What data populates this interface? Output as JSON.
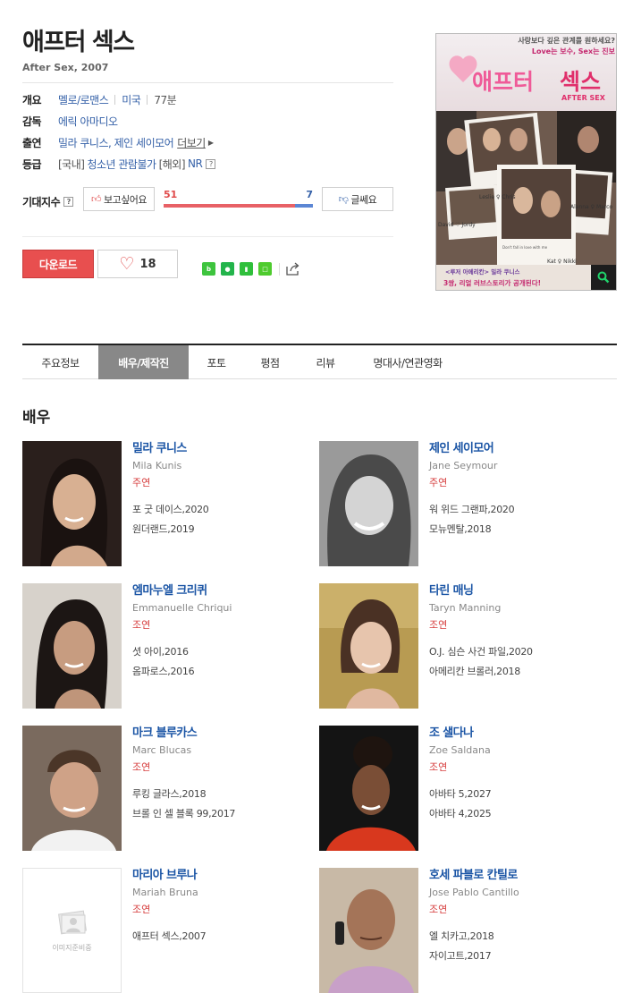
{
  "movie": {
    "title": "애프터 섹스",
    "subtitle": "After Sex, 2007"
  },
  "info": {
    "overview_label": "개요",
    "genre": "멜로/로맨스",
    "country": "미국",
    "runtime": "77분",
    "director_label": "감독",
    "director": "에릭 아마디오",
    "cast_label": "출연",
    "cast_summary": "밀라 쿠니스, 제인 세이모어",
    "more_label": "더보기",
    "rating_label": "등급",
    "rating_domestic_prefix": "[국내]",
    "rating_domestic": "청소년 관람불가",
    "rating_overseas_prefix": "[해외]",
    "rating_overseas": "NR",
    "help_glyph": "?"
  },
  "expect": {
    "label": "기대지수",
    "like_label": "보고싶어요",
    "dislike_label": "글쎄요",
    "like_count": "51",
    "dislike_count": "7",
    "like_ratio": 0.88
  },
  "actions": {
    "download_label": "다운로드",
    "like_count": "18"
  },
  "tabs": [
    {
      "label": "주요정보"
    },
    {
      "label": "배우/제작진"
    },
    {
      "label": "포토"
    },
    {
      "label": "평점"
    },
    {
      "label": "리뷰"
    },
    {
      "label": "명대사/연관영화"
    }
  ],
  "section_title": "배우",
  "cast": [
    {
      "name": "밀라 쿠니스",
      "en": "Mila Kunis",
      "role": "주연",
      "works": [
        "포 굿 데이스,2020",
        "원더랜드,2019"
      ]
    },
    {
      "name": "제인 세이모어",
      "en": "Jane Seymour",
      "role": "주연",
      "works": [
        "워 위드 그랜파,2020",
        "모뉴멘탈,2018"
      ]
    },
    {
      "name": "엠마누엘 크리퀴",
      "en": "Emmanuelle Chriqui",
      "role": "조연",
      "works": [
        "셧 아이,2016",
        "옴파로스,2016"
      ]
    },
    {
      "name": "타린 매닝",
      "en": "Taryn Manning",
      "role": "조연",
      "works": [
        "O.J. 심슨 사건 파일,2020",
        "아메리칸 브롤러,2018"
      ]
    },
    {
      "name": "마크 블루카스",
      "en": "Marc Blucas",
      "role": "조연",
      "works": [
        "루킹 글라스,2018",
        "브롤 인 셀 블록 99,2017"
      ]
    },
    {
      "name": "조 샐다나",
      "en": "Zoe Saldana",
      "role": "조연",
      "works": [
        "아바타 5,2027",
        "아바타 4,2025"
      ]
    },
    {
      "name": "마리아 브루나",
      "en": "Mariah Bruna",
      "role": "조연",
      "works": [
        "애프터 섹스,2007"
      ]
    },
    {
      "name": "호세 파블로 칸틸로",
      "en": "Jose Pablo Cantillo",
      "role": "조연",
      "works": [
        "엘 치카고,2018",
        "자이고트,2017"
      ]
    }
  ],
  "placeholder_text": "이미지준비중",
  "poster": {
    "tagline_1": "사랑보다 깊은 관계를 원하세요?",
    "tagline_2": "Love는 보수, Sex는 진보",
    "title_left": "애프터",
    "title_right": "섹스",
    "title_en": "AFTER SEX",
    "caption_1": "Leslie ♀ Chris",
    "caption_2": "Alanna ♀ Marco",
    "caption_3": "David ♡ Jordy",
    "caption_4": "Kat ♀ Nikki",
    "caption_5": "Don't fall in love with me",
    "bottom_1": "<루저 아메리칸> 밀라 쿠니스",
    "bottom_2": "3쌍, 리얼 러브스토리가 공개된다!"
  },
  "colors": {
    "like": "#e04a4a",
    "dislike": "#3561a8",
    "link": "#1b55a5",
    "role": "#d63c3c",
    "download": "#e84f4f"
  }
}
